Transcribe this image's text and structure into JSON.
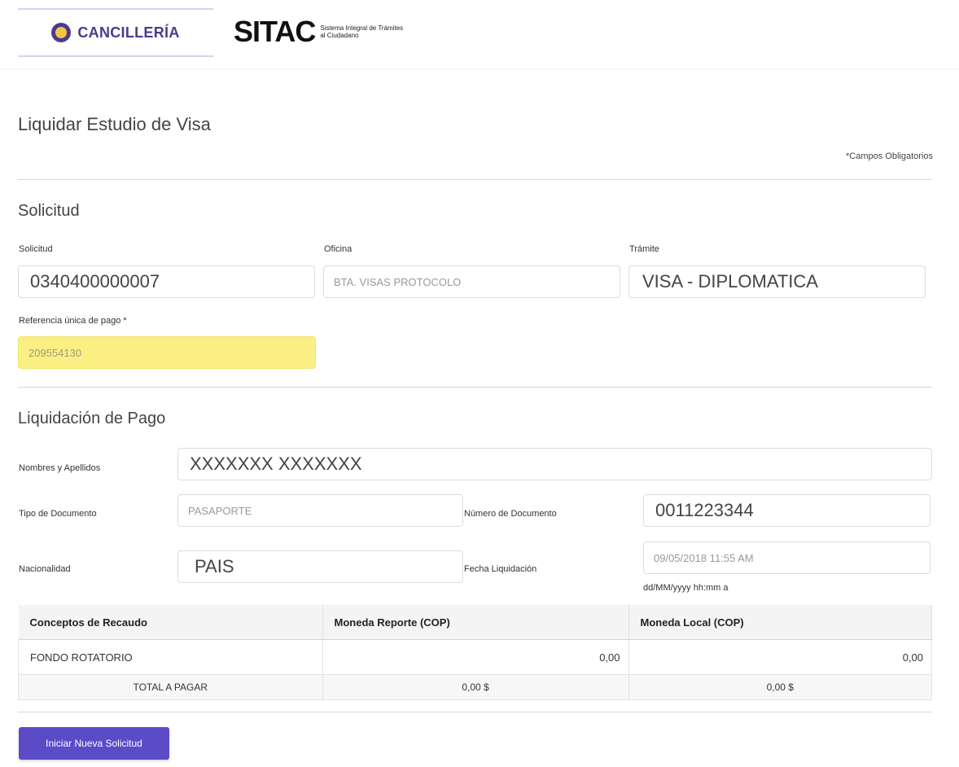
{
  "header": {
    "brand": "CANCILLERÍA",
    "logo_text": "SITAC",
    "logo_subtitle": "Sistema Integral de Trámites al Ciudadano"
  },
  "page": {
    "title": "Liquidar Estudio de Visa",
    "required_note": "*Campos Obligatorios"
  },
  "solicitud": {
    "section_title": "Solicitud",
    "solicitud_label": "Solicitud",
    "solicitud_value": "0340400000007",
    "oficina_label": "Oficina",
    "oficina_value": "BTA. VISAS PROTOCOLO",
    "tramite_label": "Trámite",
    "tramite_value": "VISA - DIPLOMATICA",
    "referencia_label": "Referencia única de pago *",
    "referencia_value": "209554130"
  },
  "liquidacion": {
    "section_title": "Liquidación de Pago",
    "nombres_label": "Nombres y Apellidos",
    "nombres_value": "XXXXXXX XXXXXXX",
    "tipo_doc_label": "Tipo de Documento",
    "tipo_doc_value": "PASAPORTE",
    "numero_doc_label": "Número de Documento",
    "numero_doc_value": "0011223344",
    "nacionalidad_label": "Nacionalidad",
    "nacionalidad_value": "PAIS",
    "fecha_label": "Fecha Liquidación",
    "fecha_value": "09/05/2018 11:55 AM",
    "fecha_format": "dd/MM/yyyy hh:mm a"
  },
  "table": {
    "headers": [
      "Conceptos de Recaudo",
      "Moneda Reporte (COP)",
      "Moneda Local (COP)"
    ],
    "rows": [
      {
        "concepto": "FONDO ROTATORIO",
        "reporte": "0,00",
        "local": "0,00"
      }
    ],
    "total": {
      "label": "TOTAL A PAGAR",
      "reporte": "0,00 $",
      "local": "0,00 $"
    }
  },
  "actions": {
    "new_request": "Iniciar Nueva Solicitud"
  },
  "colors": {
    "brand": "#4b3a8c",
    "button": "#5b4bc7",
    "highlight": "#fbef84"
  }
}
